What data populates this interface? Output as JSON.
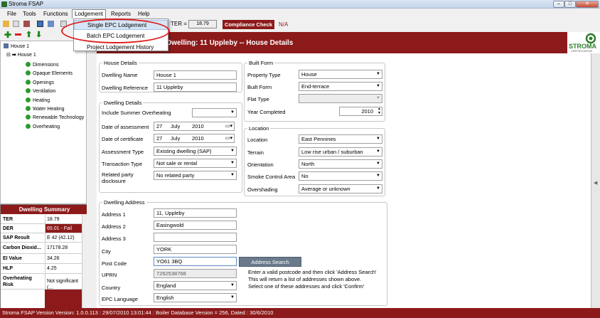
{
  "window": {
    "title": "Stroma FSAP",
    "min": "–",
    "max": "□",
    "close": "✕"
  },
  "menu": [
    "File",
    "Tools",
    "Functions",
    "Lodgement",
    "Reports",
    "Help"
  ],
  "lodgement_menu": {
    "items": [
      "Single EPC Lodgement",
      "Batch EPC Lodgement",
      "Project Lodgement History"
    ]
  },
  "toolbar": {
    "ter_label": "TER =",
    "ter_value": "18.79",
    "compliance_label": "Compliance Check",
    "compliance_value": "N/A"
  },
  "header": {
    "title": "Dwelling: 11 Uppleby -- House Details"
  },
  "logo": {
    "name": "STROMA",
    "sub": "CERTIFICATION",
    "color": "#2f7d2f"
  },
  "tree": {
    "root": "House 1",
    "child": "House 1",
    "items": [
      "Dimensions",
      "Opaque Elements",
      "Openings",
      "Ventilation",
      "Heating",
      "Water Heating",
      "Renewable Technology",
      "Overheating"
    ]
  },
  "summary": {
    "title": "Dwelling Summary",
    "rows": [
      {
        "k": "TER",
        "v": "18.79"
      },
      {
        "k": "DER",
        "v": "65.01 - Fail"
      },
      {
        "k": "SAP Result",
        "v": "E 42 (42.12)"
      },
      {
        "k": "Carbon Dioxid...",
        "v": "17178.28"
      },
      {
        "k": "EI Value",
        "v": "34.26"
      },
      {
        "k": "HLP",
        "v": "4.25"
      },
      {
        "k": "Overheating Risk",
        "v": "Not significant (..."
      }
    ]
  },
  "house": {
    "legend": "House Details",
    "dwelling_name_label": "Dwelling Name",
    "dwelling_name": "House 1",
    "dwelling_ref_label": "Dwelling Reference",
    "dwelling_ref": "11 Uppleby"
  },
  "details": {
    "legend": "Dwelling Details",
    "summer_label": "Include Summer Overheating",
    "summer_value": "",
    "assess_label": "Date of assessment",
    "assess_day": "27",
    "assess_month": "July",
    "assess_year": "2010",
    "cert_label": "Date of certificate",
    "cert_day": "27",
    "cert_month": "July",
    "cert_year": "2010",
    "atype_label": "Assessment Type",
    "atype_value": "Existing dwelling (SAP)",
    "ttype_label": "Transaction Type",
    "ttype_value": "Not sale or rental",
    "related_label": "Related party disclosure",
    "related_value": "No related party"
  },
  "built": {
    "legend": "Built Form",
    "ptype_label": "Property Type",
    "ptype_value": "House",
    "bform_label": "Built Form",
    "bform_value": "End-terrace",
    "flat_label": "Flat Type",
    "flat_value": "",
    "year_label": "Year Completed",
    "year_value": "2010"
  },
  "location": {
    "legend": "Location",
    "loc_label": "Location",
    "loc_value": "East Pennines",
    "terrain_label": "Terrain",
    "terrain_value": "Low rise urban / suburban",
    "orient_label": "Orientation",
    "orient_value": "North",
    "smoke_label": "Smoke Control Area",
    "smoke_value": "No",
    "shading_label": "Overshading",
    "shading_value": "Average or unknown"
  },
  "address": {
    "legend": "Dwelling Address",
    "a1_label": "Address 1",
    "a1": "11, Uppleby",
    "a2_label": "Address 2",
    "a2": "Easingwold",
    "a3_label": "Address 3",
    "a3": "",
    "city_label": "City",
    "city": "YORK",
    "post_label": "Post Code",
    "post": "YO61 3BQ",
    "search_button": "Address Search",
    "uprn_label": "UPRN",
    "uprn": "7262538768",
    "country_label": "Country",
    "country": "England",
    "lang_label": "EPC Language",
    "lang": "English",
    "note1": "Enter a valid postcode and then click 'Address Search'",
    "note2": "This will return a list of addresses shown above.",
    "note3": "Select one of these addresses and click 'Confirm'"
  },
  "status": {
    "text": "Stroma FSAP Version Version: 1.0.0.113 : 29/07/2010 13:01:44 : Boiler Database Version = 256, Dated : 30/6/2010"
  }
}
